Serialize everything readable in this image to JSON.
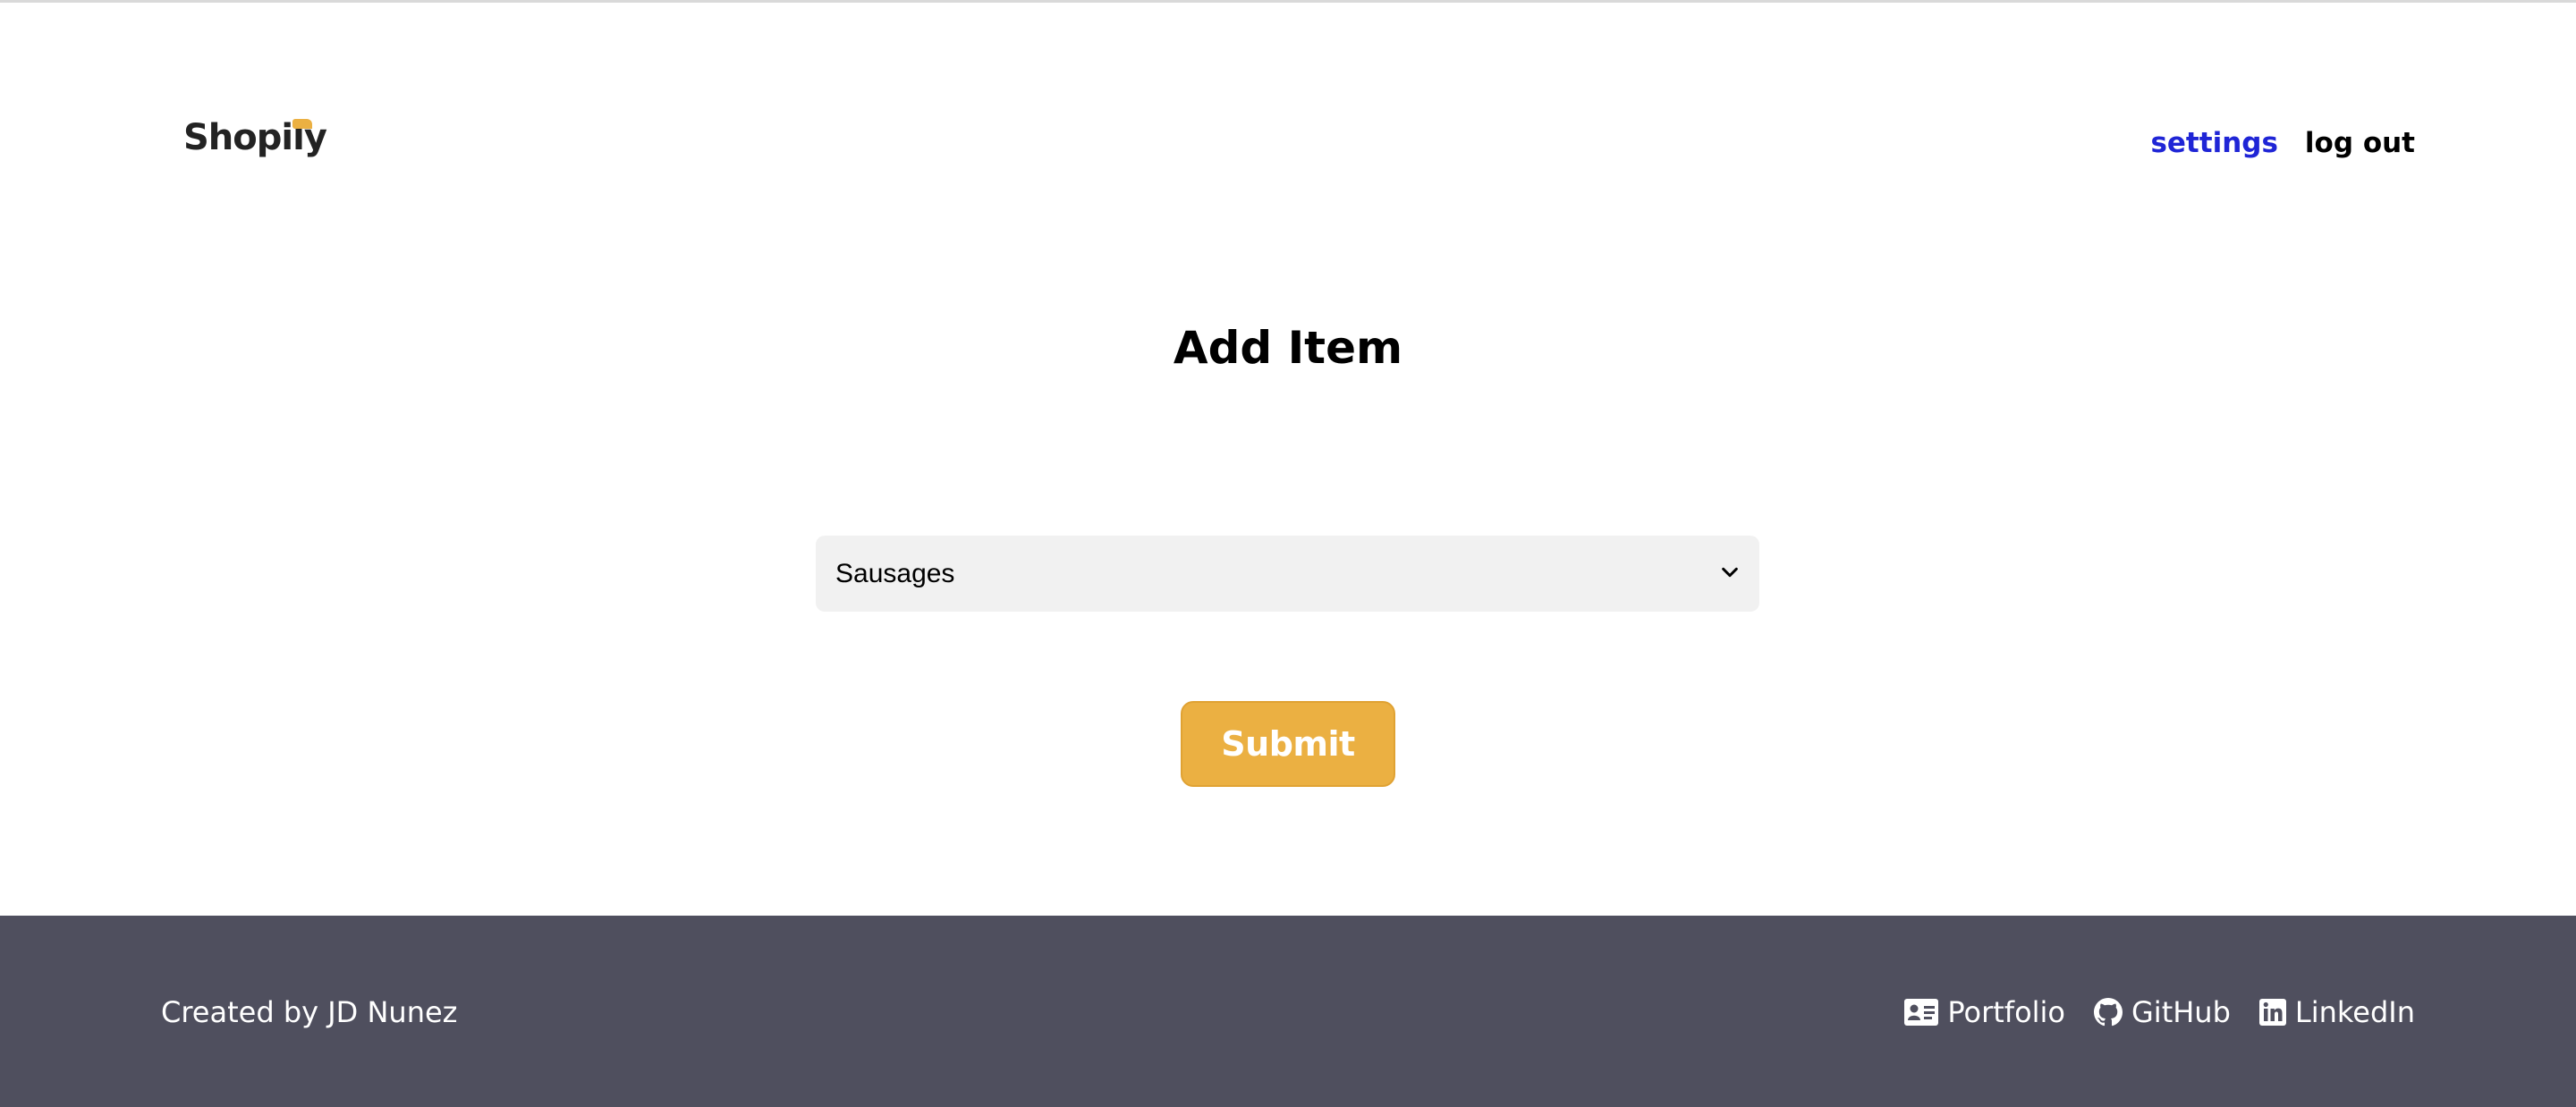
{
  "header": {
    "logo_text": "Shopily",
    "nav": {
      "settings_label": "settings",
      "logout_label": "log out"
    }
  },
  "main": {
    "title": "Add Item",
    "item_select": {
      "selected_value": "Sausages"
    },
    "submit_label": "Submit"
  },
  "footer": {
    "credit": "Created by JD Nunez",
    "links": [
      {
        "label": "Portfolio",
        "icon": "id-card-icon"
      },
      {
        "label": "GitHub",
        "icon": "github-icon"
      },
      {
        "label": "LinkedIn",
        "icon": "linkedin-icon"
      }
    ]
  },
  "colors": {
    "accent": "#ebb042",
    "settings_link": "#1f25d6",
    "footer_bg": "#4f4f5e",
    "select_bg": "#f1f1f1"
  }
}
